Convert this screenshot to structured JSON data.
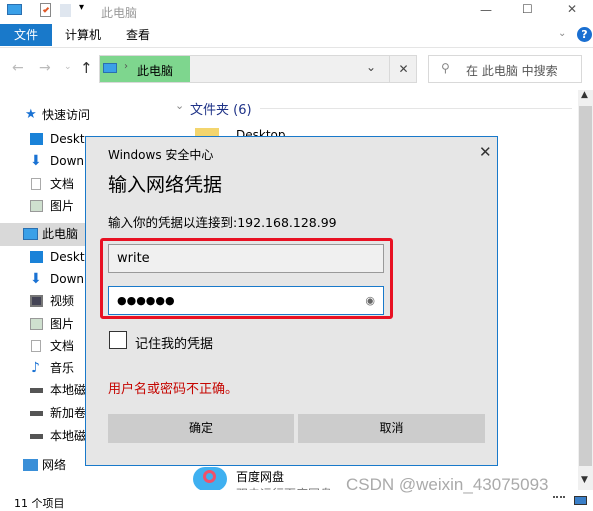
{
  "window": {
    "title": "此电脑",
    "controls": {
      "minimize": "—",
      "maximize": "☐",
      "close": "✕"
    }
  },
  "ribbon": {
    "tabs": [
      {
        "label": "文件"
      },
      {
        "label": "计算机"
      },
      {
        "label": "查看"
      }
    ],
    "help": "?"
  },
  "address": {
    "location": "此电脑",
    "search_placeholder": "在 此电脑 中搜索"
  },
  "nav": {
    "quick_access": "快速访问",
    "quick_items": [
      "Desktop",
      "Downloads",
      "文档",
      "图片"
    ],
    "this_pc": "此电脑",
    "pc_items": [
      "Desktop",
      "Downloads",
      "视频",
      "图片",
      "文档",
      "音乐",
      "本地磁盘 (C:)",
      "新加卷 (D:)",
      "本地磁盘 (E:)"
    ],
    "network": "网络"
  },
  "content": {
    "group_header": "文件夹 (6)",
    "folder_label": "Desktop",
    "app_name": "百度网盘",
    "app_desc": "双击运行百度网盘"
  },
  "status": {
    "items_count": "11 个项目"
  },
  "dialog": {
    "app_title": "Windows 安全中心",
    "heading": "输入网络凭据",
    "description": "输入你的凭据以连接到:192.168.128.99",
    "username": "write",
    "password": "●●●●●●",
    "remember_label": "记住我的凭据",
    "remember_checked": false,
    "error": "用户名或密码不正确。",
    "ok": "确定",
    "cancel": "取消",
    "highlight_color": "#e81123",
    "error_color": "#c50500"
  },
  "watermark": "CSDN @weixin_43075093",
  "colors": {
    "accent": "#1979ca",
    "address_highlight": "#7ed68e"
  }
}
